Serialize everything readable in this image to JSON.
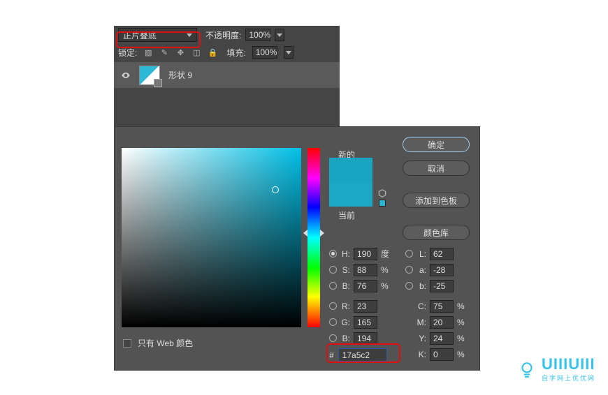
{
  "layers": {
    "blend_mode": "正片叠底",
    "opacity_label": "不透明度:",
    "opacity_value": "100%",
    "lock_label": "锁定:",
    "fill_label": "填充:",
    "fill_value": "100%",
    "layer_name": "形状 9"
  },
  "picker": {
    "new_label": "新的",
    "current_label": "当前",
    "buttons": {
      "ok": "确定",
      "cancel": "取消",
      "add": "添加到色板",
      "lib": "颜色库"
    },
    "hsb": {
      "h_label": "H:",
      "h_val": "190",
      "h_unit": "度",
      "s_label": "S:",
      "s_val": "88",
      "s_unit": "%",
      "b_label": "B:",
      "b_val": "76",
      "b_unit": "%"
    },
    "rgb": {
      "r_label": "R:",
      "r_val": "23",
      "g_label": "G:",
      "g_val": "165",
      "b_label": "B:",
      "b_val": "194"
    },
    "lab": {
      "l_label": "L:",
      "l_val": "62",
      "a_label": "a:",
      "a_val": "-28",
      "b_label": "b:",
      "b_val": "-25"
    },
    "cmyk": {
      "c_label": "C:",
      "c_val": "75",
      "m_label": "M:",
      "m_val": "20",
      "y_label": "Y:",
      "y_val": "24",
      "k_label": "K:",
      "k_val": "0",
      "unit": "%"
    },
    "hex_label": "#",
    "hex_value": "17a5c2",
    "web_only": "只有 Web 颜色"
  },
  "watermark": {
    "text": "UIIIUIII",
    "sub": "自学网上优优网"
  },
  "colors": {
    "new": "#17a5c2",
    "current": "#1aa8c4",
    "highlight": "#e11010"
  }
}
